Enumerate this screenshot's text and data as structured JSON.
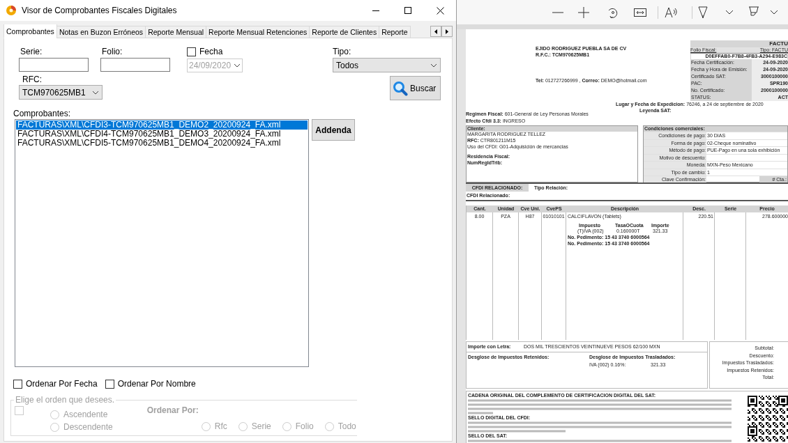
{
  "window": {
    "title": "Visor de Comprobantes Fiscales Digitales"
  },
  "tabs": [
    {
      "label": "Comprobantes",
      "selected": true
    },
    {
      "label": "Notas en Buzon Erróneos",
      "selected": false
    },
    {
      "label": "Reporte Mensual",
      "selected": false
    },
    {
      "label": "Reporte Mensual Retenciones",
      "selected": false
    },
    {
      "label": "Reporte de Clientes",
      "selected": false
    },
    {
      "label": "Reporte",
      "selected": false
    }
  ],
  "form": {
    "serie": {
      "label": "Serie:"
    },
    "folio": {
      "label": "Folio:"
    },
    "fecha": {
      "label": "Fecha",
      "checked": false,
      "value": "24/09/2020",
      "disabled": true
    },
    "tipo": {
      "label": "Tipo:",
      "value": "Todos"
    },
    "rfc": {
      "label": "RFC:",
      "value": "TCM970625MB1"
    },
    "search_button": "Buscar"
  },
  "list": {
    "label": "Comprobantes:",
    "items": [
      {
        "text": "FACTURAS\\XML\\CFDI3-TCM970625MB1_DEMO2_20200924_FA.xml",
        "selected": true
      },
      {
        "text": "FACTURAS\\XML\\CFDI4-TCM970625MB1_DEMO3_20200924_FA.xml",
        "selected": false
      },
      {
        "text": "FACTURAS\\XML\\CFDI5-TCM970625MB1_DEMO4_20200924_FA.xml",
        "selected": false
      }
    ]
  },
  "addenda_button": "Addenda",
  "sort_options": [
    {
      "label": "Ordenar Por Fecha",
      "checked": false
    },
    {
      "label": "Ordenar Por Nombre",
      "checked": false
    }
  ],
  "order_group": {
    "title": "Elige el orden que desees.",
    "disabled": true,
    "checked": false,
    "directions": [
      {
        "label": "Ascendente",
        "selected": false
      },
      {
        "label": "Descendente",
        "selected": false
      }
    ],
    "fields_label": "Ordenar Por:",
    "fields": [
      {
        "label": "Rfc",
        "selected": false
      },
      {
        "label": "Serie",
        "selected": false
      },
      {
        "label": "Folio",
        "selected": false
      },
      {
        "label": "Todo",
        "selected": false
      }
    ]
  },
  "document": {
    "issuer": {
      "name": "EJIDO RODRIGUEZ PUEBLA SA DE CV",
      "rfc": "R.F.C.: TCM970625MB1",
      "contact": "**Tel:** 012727266999 , **Correo:** DEMO@hotmail.com"
    },
    "header_box": {
      "title": "FACTU",
      "folio_label": "Folio Fiscal:",
      "tipo": "Tipo: FACTU",
      "uuid": "D0EFFAB0-F7B8-4FB3-A294-E983C",
      "rows": [
        {
          "label": "Fecha Certificación:",
          "value": "24-09-2020"
        },
        {
          "label": "Fecha y Hora de Emisión:",
          "value": "24-09-2020"
        },
        {
          "label": "Certificado SAT:",
          "value": "3000100000"
        },
        {
          "label": "PAC:",
          "value": "SPR190"
        },
        {
          "label": "No. Certificado:",
          "value": "2000100000"
        },
        {
          "label": "STATUS:",
          "value": "ACT"
        }
      ]
    },
    "lugar": "**Lugar y Fecha de Expedicion:** 76246, a 24 de septiembre de 2020",
    "leyenda": "Leyenda SAT:",
    "regimen": "**Regimen Fiscal:** 601-General de Ley Personas Morales",
    "efecto": "**Efecto Cfdi 3.3:** INGRESO",
    "cliente": {
      "title": "Cliente:",
      "lines": [
        "MARGARITA RODRIGUEZ TELLEZ",
        "**RFC:** CTR801211M15",
        "Uso del CFDI: G01-Adquisición de mercancias"
      ],
      "fields": [
        "Residencia Fiscal:",
        "NumRegIdTrib:"
      ]
    },
    "condiciones": {
      "title": "Condiciones comerciales:",
      "rows": [
        {
          "label": "Condiciones de pago:",
          "value": "30 DIAS"
        },
        {
          "label": "Forma de pago:",
          "value": "02-Cheque nominativo"
        },
        {
          "label": "Método de pago:",
          "value": "PUE-Pago en una sola exhibición"
        },
        {
          "label": "Motivo de descuento:"
        },
        {
          "label": "Moneda:",
          "value": "MXN-Peso Mexicano"
        },
        {
          "label": "Tipo de cambio:",
          "value": "1"
        },
        {
          "label": "Clave  Confirmación:",
          "extra": "# Cta.:"
        }
      ]
    },
    "relacionado": {
      "label": "CFDI RELACIONADO:",
      "tipo": "Tipo Relación:",
      "cfdi": "CFDI Relacionado:"
    },
    "items_table": {
      "columns": [
        "Cant.",
        "Unidad",
        "Cve Uni.",
        "CvePS",
        "Descripción",
        "Desc.",
        "Serie",
        "Precio"
      ],
      "rows": [
        {
          "cant": "8.00",
          "unidad": "PZA",
          "cve_uni": "H87",
          "cveps": "01010101",
          "descripcion": "CALCIFLAVON (Tablets)",
          "desc": "220.51",
          "precio": "278.600000",
          "tax_columns": [
            "Impuesto",
            "TasaOCuota",
            "Importe"
          ],
          "taxes": [
            [
              "(T)IVA (002)",
              "0.160000T",
              "321.33"
            ]
          ],
          "pedimentos": [
            "No. Pedimento: 15 43 3740 6000564",
            "No. Pedimento: 15 43 3740 6000564"
          ]
        }
      ]
    },
    "importe_letra": {
      "label": "Importe con Letra:",
      "value": "DOS MIL TRESCIENTOS VEINTINUEVE PESOS 62/100 MXN"
    },
    "retenidos": "Desglose de Impuestos Retenidos:",
    "trasladados": {
      "label": "Desglose de Impuestos Trasladados:",
      "rows": [
        [
          "IVA (002) 0.16%:",
          "321.33"
        ]
      ]
    },
    "totals": [
      "Subtotal:",
      "Descuento:",
      "Impuestos Trasladados:",
      "Impuestos Retenidos:",
      "Total:"
    ],
    "sellos": [
      "CADENA ORIGINAL DEL COMPLEMENTO DE CERTIFICACION DIGITAL DEL SAT:",
      "SELLO DIGITAL DEL CFDI:",
      "SELLO DEL SAT:"
    ]
  }
}
